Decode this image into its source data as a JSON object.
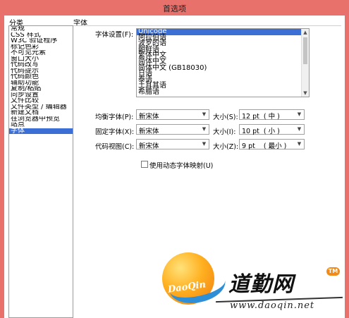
{
  "window": {
    "title": "首选项"
  },
  "sidebar": {
    "header": "分类",
    "items": [
      {
        "label": "常规"
      },
      {
        "label": "CSS 样式"
      },
      {
        "label": "W3C 验证程序"
      },
      {
        "label": "标记色彩"
      },
      {
        "label": "不可见元素"
      },
      {
        "label": "窗口大小"
      },
      {
        "label": "代码改写"
      },
      {
        "label": "代码提示"
      },
      {
        "label": "代码颜色"
      },
      {
        "label": "辅助功能"
      },
      {
        "label": "复制/粘贴"
      },
      {
        "label": "同步设置"
      },
      {
        "label": "文件比较"
      },
      {
        "label": "文件类型 / 编辑器"
      },
      {
        "label": "新建文档"
      },
      {
        "label": "在浏览器中预览"
      },
      {
        "label": "站点"
      },
      {
        "label": "字体",
        "selected": true
      }
    ]
  },
  "fonts": {
    "section_title": "字体",
    "encoding_label": "字体设置(F):",
    "encodings": [
      {
        "label": "Unicode",
        "selected": true
      },
      {
        "label": "阿拉伯语"
      },
      {
        "label": "波罗的语"
      },
      {
        "label": "朝鲜语"
      },
      {
        "label": "繁体中文"
      },
      {
        "label": "简体中文"
      },
      {
        "label": "简体中文 (GB18030)"
      },
      {
        "label": "日语"
      },
      {
        "label": "泰语"
      },
      {
        "label": "土耳其语"
      },
      {
        "label": "希腊语"
      }
    ],
    "proportional": {
      "label": "均衡字体(P):",
      "value": "新宋体",
      "size_label": "大小(S):",
      "size_value": "12 pt  ( 中 )"
    },
    "fixed": {
      "label": "固定字体(X):",
      "value": "新宋体",
      "size_label": "大小(I):",
      "size_value": "10 pt  ( 小 )"
    },
    "code_view": {
      "label": "代码视图(C):",
      "value": "新宋体",
      "size_label": "大小(Z):",
      "size_value": "9 pt    ( 最小 )"
    },
    "dynamic_mapping": {
      "label": "使用动态字体映射(U)",
      "checked": false
    }
  },
  "watermark": {
    "logo_text": "DaoQin",
    "brand_name": "道勤网",
    "trademark": "TM",
    "url": "www.daoqin.net"
  }
}
